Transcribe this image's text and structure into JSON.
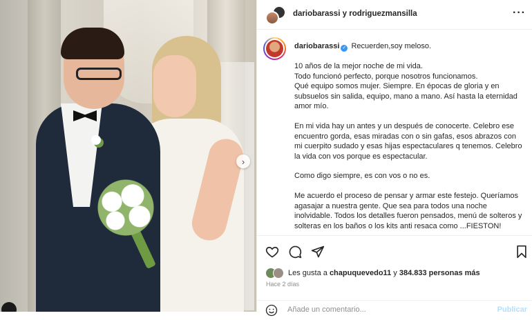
{
  "header": {
    "user1": "dariobarassi",
    "joiner": "y",
    "user2": "rodriguezmansilla",
    "more_icon": "more-horizontal-icon"
  },
  "caption": {
    "username": "dariobarassi",
    "headline": "Recuerden,soy meloso.",
    "paragraphs": [
      "10 años de la mejor noche de mi vida.\nTodo funcionó perfecto, porque nosotros funcionamos.\nQué equipo somos mujer. Siempre. En épocas de gloria y en subsuelos sin salida, equipo, mano a mano. Así hasta la eternidad amor mío.",
      "En mi vida hay un antes y un después de conocerte. Celebro ese encuentro gorda, esas miradas con o sin gafas, esos abrazos con mi cuerpito sudado y esas hijas espectaculares q tenemos. Celebro la vida con vos porque es espectacular.",
      "Como digo siempre, es con vos o no es.",
      "Me acuerdo el proceso de pensar y armar este festejo. Queríamos agasajar a nuestra gente. Que sea para todos una noche inolvidable. Todos los detalles fueron pensados, menú de solteros y solteras en los baños o los kits anti resaca como ...FIESTON!"
    ]
  },
  "likes": {
    "prefix": "Les gusta a",
    "user": "chapuquevedo11",
    "middle": "y",
    "count": "384.833 personas más"
  },
  "time": "Hace 2 días",
  "comment": {
    "placeholder": "Añade un comentario...",
    "publish": "Publicar"
  },
  "icons": [
    "heart-icon",
    "comment-icon",
    "share-icon",
    "bookmark-icon",
    "emoji-icon",
    "chevron-right-icon"
  ],
  "colors": {
    "verified": "#3897f0",
    "publish": "#b2dffc",
    "muted": "#8e8e8e"
  }
}
